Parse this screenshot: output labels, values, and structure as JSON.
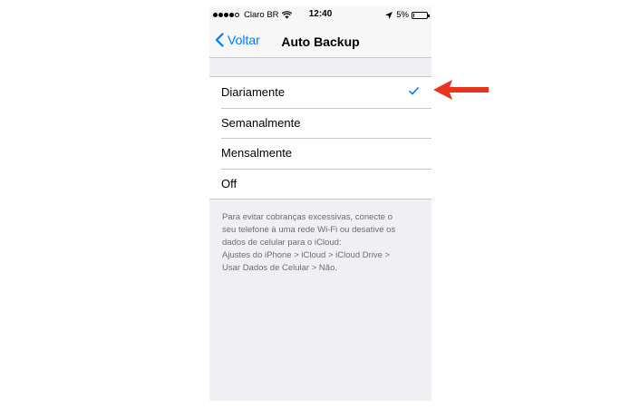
{
  "status_bar": {
    "carrier": "Claro BR",
    "time": "12:40",
    "battery": "5%",
    "battery_level": 0.05,
    "signal_bars": 4
  },
  "nav": {
    "back_label": "Voltar",
    "title": "Auto Backup"
  },
  "options": [
    {
      "label": "Diariamente",
      "selected": true
    },
    {
      "label": "Semanalmente",
      "selected": false
    },
    {
      "label": "Mensalmente",
      "selected": false
    },
    {
      "label": "Off",
      "selected": false
    }
  ],
  "footer": {
    "lines": [
      "Para evitar cobranças excessivas, conecte o",
      "seu telefone à uma rede Wi-Fi ou desative os",
      "dados de celular para o iCloud:",
      "Ajustes do iPhone > iCloud > iCloud Drive >",
      "Usar Dados de Celular > Não."
    ]
  },
  "colors": {
    "accent": "#007aff",
    "annotation_arrow": "#e8341c"
  },
  "icons": {
    "back": "chevron-left-icon",
    "selected": "checkmark-icon",
    "annotation": "red-arrow-icon"
  }
}
